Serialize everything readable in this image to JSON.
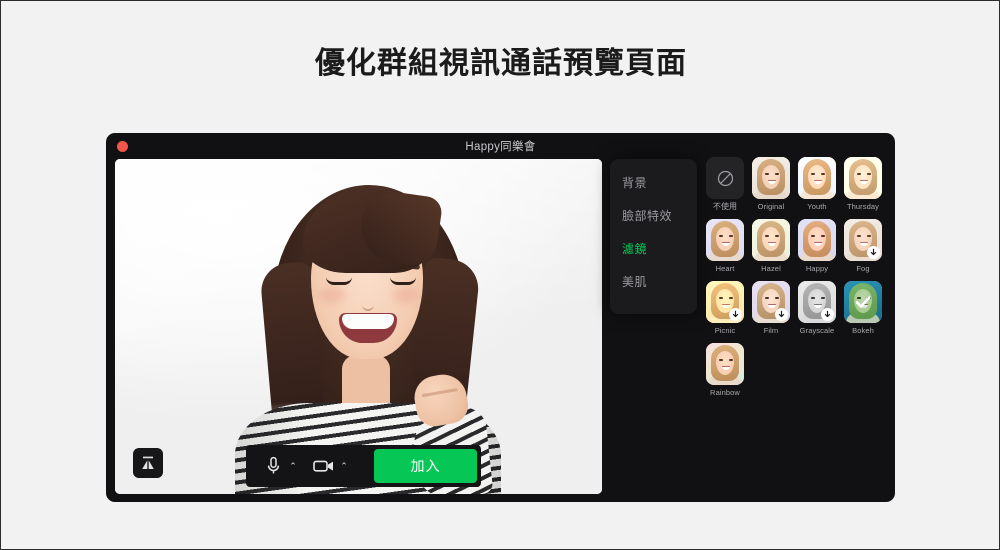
{
  "page": {
    "title": "優化群組視訊通話預覽頁面",
    "background_color": "#f2f2f2"
  },
  "window": {
    "title": "Happy同樂會",
    "close_dot_color": "#f2564b",
    "background_color": "#111113"
  },
  "video": {
    "flip_icon": "mirror-flip-icon"
  },
  "controls": {
    "mic": {
      "icon": "microphone-icon",
      "chevron": "⌃"
    },
    "camera": {
      "icon": "video-camera-icon",
      "chevron": "⌃"
    },
    "join_label": "加入",
    "join_color": "#06c755"
  },
  "menu": {
    "accent_color": "#06c755",
    "items": [
      {
        "label": "背景",
        "active": false
      },
      {
        "label": "臉部特效",
        "active": false
      },
      {
        "label": "濾鏡",
        "active": true
      },
      {
        "label": "美肌",
        "active": false
      }
    ]
  },
  "filters": {
    "selected": "Bokeh",
    "rows": [
      [
        {
          "label": "不使用",
          "kind": "none",
          "icon": "no-filter-icon",
          "tint": "none",
          "downloadable": false,
          "selected": false,
          "cjk": true
        },
        {
          "label": "Original",
          "kind": "photo",
          "tint": "original",
          "downloadable": false,
          "selected": false
        },
        {
          "label": "Youth",
          "kind": "photo",
          "tint": "youth",
          "downloadable": false,
          "selected": false
        },
        {
          "label": "Thursday",
          "kind": "photo",
          "tint": "thursday",
          "downloadable": false,
          "selected": false
        }
      ],
      [
        {
          "label": "Heart",
          "kind": "photo",
          "tint": "heart",
          "downloadable": false,
          "selected": false
        },
        {
          "label": "Hazel",
          "kind": "photo",
          "tint": "hazel",
          "downloadable": false,
          "selected": false
        },
        {
          "label": "Happy",
          "kind": "photo",
          "tint": "happy",
          "downloadable": false,
          "selected": false
        },
        {
          "label": "Fog",
          "kind": "photo",
          "tint": "fog",
          "downloadable": true,
          "selected": false
        }
      ],
      [
        {
          "label": "Picnic",
          "kind": "photo",
          "tint": "picnic",
          "downloadable": true,
          "selected": false
        },
        {
          "label": "Film",
          "kind": "photo",
          "tint": "film",
          "downloadable": true,
          "selected": false
        },
        {
          "label": "Grayscale",
          "kind": "photo",
          "tint": "grayscale",
          "downloadable": true,
          "selected": false
        },
        {
          "label": "Bokeh",
          "kind": "photo",
          "tint": "bokeh",
          "downloadable": false,
          "selected": true
        }
      ],
      [
        {
          "label": "Rainbow",
          "kind": "photo",
          "tint": "rainbow",
          "downloadable": false,
          "selected": false
        }
      ]
    ]
  }
}
